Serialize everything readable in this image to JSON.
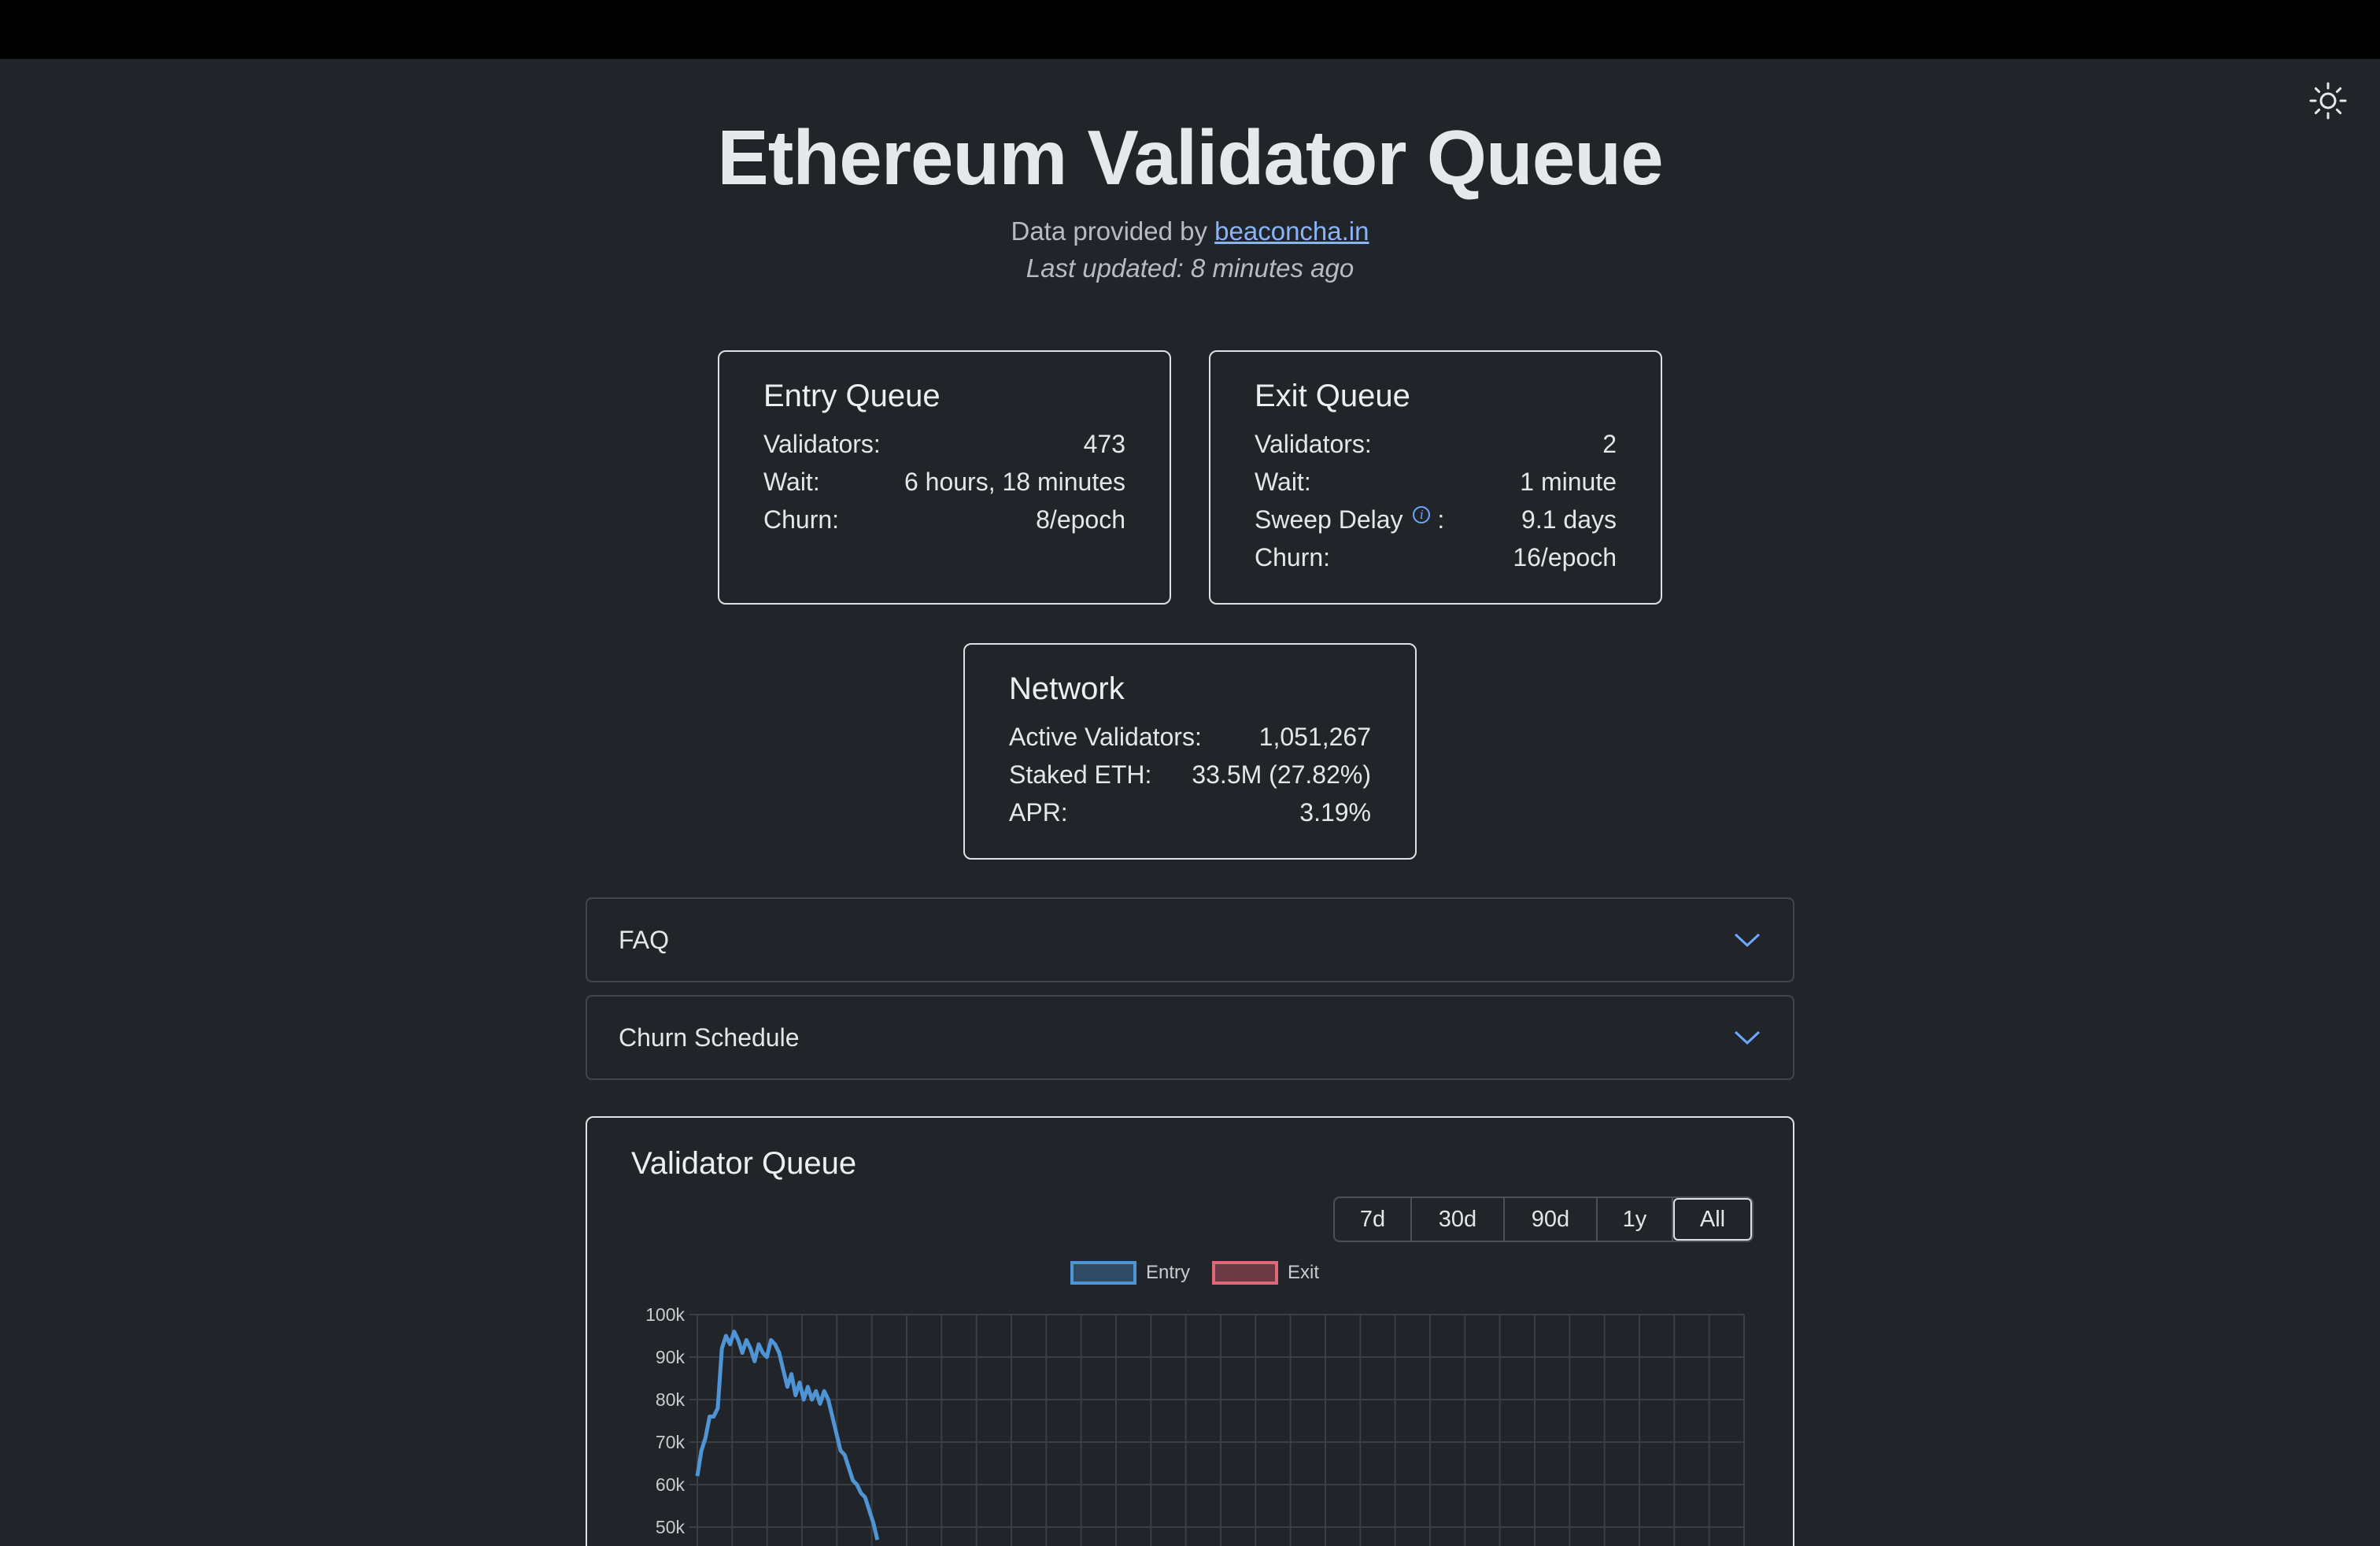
{
  "header": {
    "title": "Ethereum Validator Queue",
    "provided_prefix": "Data provided by ",
    "provided_link": "beaconcha.in",
    "last_updated": "Last updated: 8 minutes ago"
  },
  "icons": {
    "theme_toggle": "sun-icon",
    "accordion_chevron": "chevron-down-icon",
    "info": "info-circle-icon"
  },
  "entry_queue": {
    "title": "Entry Queue",
    "rows": [
      {
        "label": "Validators:",
        "value": "473"
      },
      {
        "label": "Wait:",
        "value": "6 hours, 18 minutes"
      },
      {
        "label": "Churn:",
        "value": "8/epoch"
      }
    ]
  },
  "exit_queue": {
    "title": "Exit Queue",
    "validators_label": "Validators:",
    "validators_value": "2",
    "wait_label": "Wait:",
    "wait_value": "1 minute",
    "sweep_label": "Sweep Delay",
    "sweep_suffix": ":",
    "sweep_value": "9.1 days",
    "churn_label": "Churn:",
    "churn_value": "16/epoch"
  },
  "network": {
    "title": "Network",
    "rows": [
      {
        "label": "Active Validators:",
        "value": "1,051,267"
      },
      {
        "label": "Staked ETH:",
        "value": "33.5M (27.82%)"
      },
      {
        "label": "APR:",
        "value": "3.19%"
      }
    ]
  },
  "accordions": [
    {
      "label": "FAQ"
    },
    {
      "label": "Churn Schedule"
    }
  ],
  "chart_card": {
    "title": "Validator Queue",
    "ranges": [
      "7d",
      "30d",
      "90d",
      "1y",
      "All"
    ],
    "active_range": "All"
  },
  "colors": {
    "entry": "#4f94d4",
    "exit": "#e0687a",
    "background": "#212529"
  },
  "chart_data": {
    "type": "line",
    "title": "",
    "y_ticks": [
      "100k",
      "90k",
      "80k",
      "70k",
      "60k",
      "50k"
    ],
    "ylim_visible": [
      45000,
      100000
    ],
    "grid": true,
    "legend_position": "top-center",
    "series": [
      {
        "name": "Entry",
        "values": [
          62000,
          68000,
          71000,
          76000,
          76000,
          78000,
          92000,
          95000,
          93000,
          96000,
          94000,
          91000,
          94000,
          92000,
          89000,
          93000,
          91000,
          90000,
          94000,
          93000,
          91000,
          87000,
          83000,
          86000,
          81000,
          84000,
          80000,
          83000,
          80000,
          82000,
          79000,
          82000,
          80000,
          76000,
          72000,
          68000,
          67000,
          64000,
          61000,
          60000,
          58000,
          57000,
          54000,
          51000,
          47000
        ]
      },
      {
        "name": "Exit",
        "values": []
      }
    ]
  }
}
